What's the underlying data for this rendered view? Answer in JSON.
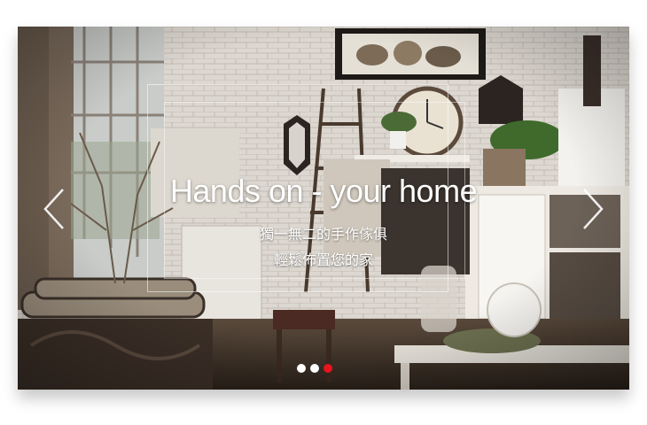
{
  "slider": {
    "title": "Hands on - your home",
    "subtitle_line1": "獨一無二的手作傢俱",
    "subtitle_line2": "輕鬆佈置您的家",
    "active_index": 2,
    "slide_count": 3
  },
  "colors": {
    "active_dot": "#e8141c",
    "inactive_dot": "#ffffff",
    "text": "#ffffff"
  },
  "icons": {
    "prev": "chevron-left-icon",
    "next": "chevron-right-icon"
  }
}
